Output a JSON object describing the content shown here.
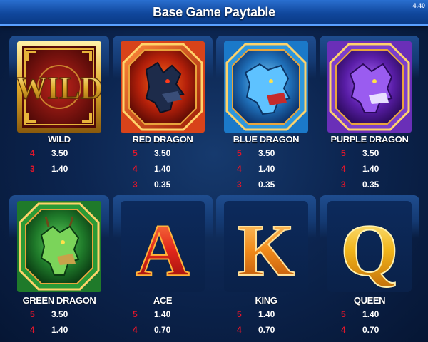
{
  "header": {
    "title": "Base Game Paytable",
    "version": "4.40"
  },
  "symbols": [
    {
      "name": "WILD",
      "icon": "wild-symbol-icon",
      "pays": [
        {
          "count": "4",
          "value": "3.50"
        },
        {
          "count": "3",
          "value": "1.40"
        }
      ]
    },
    {
      "name": "RED DRAGON",
      "icon": "red-dragon-icon",
      "pays": [
        {
          "count": "5",
          "value": "3.50"
        },
        {
          "count": "4",
          "value": "1.40"
        },
        {
          "count": "3",
          "value": "0.35"
        }
      ]
    },
    {
      "name": "BLUE DRAGON",
      "icon": "blue-dragon-icon",
      "pays": [
        {
          "count": "5",
          "value": "3.50"
        },
        {
          "count": "4",
          "value": "1.40"
        },
        {
          "count": "3",
          "value": "0.35"
        }
      ]
    },
    {
      "name": "PURPLE DRAGON",
      "icon": "purple-dragon-icon",
      "pays": [
        {
          "count": "5",
          "value": "3.50"
        },
        {
          "count": "4",
          "value": "1.40"
        },
        {
          "count": "3",
          "value": "0.35"
        }
      ]
    },
    {
      "name": "GREEN DRAGON",
      "icon": "green-dragon-icon",
      "pays": [
        {
          "count": "5",
          "value": "3.50"
        },
        {
          "count": "4",
          "value": "1.40"
        }
      ]
    },
    {
      "name": "ACE",
      "icon": "ace-letter-icon",
      "letter": "A",
      "pays": [
        {
          "count": "5",
          "value": "1.40"
        },
        {
          "count": "4",
          "value": "0.70"
        }
      ]
    },
    {
      "name": "KING",
      "icon": "king-letter-icon",
      "letter": "K",
      "pays": [
        {
          "count": "5",
          "value": "1.40"
        },
        {
          "count": "4",
          "value": "0.70"
        }
      ]
    },
    {
      "name": "QUEEN",
      "icon": "queen-letter-icon",
      "letter": "Q",
      "pays": [
        {
          "count": "5",
          "value": "1.40"
        },
        {
          "count": "4",
          "value": "0.70"
        }
      ]
    }
  ],
  "colors": {
    "count": "#e0162b",
    "value": "#ffffff",
    "background": "#0c2550",
    "title_bar": "#10479c"
  }
}
